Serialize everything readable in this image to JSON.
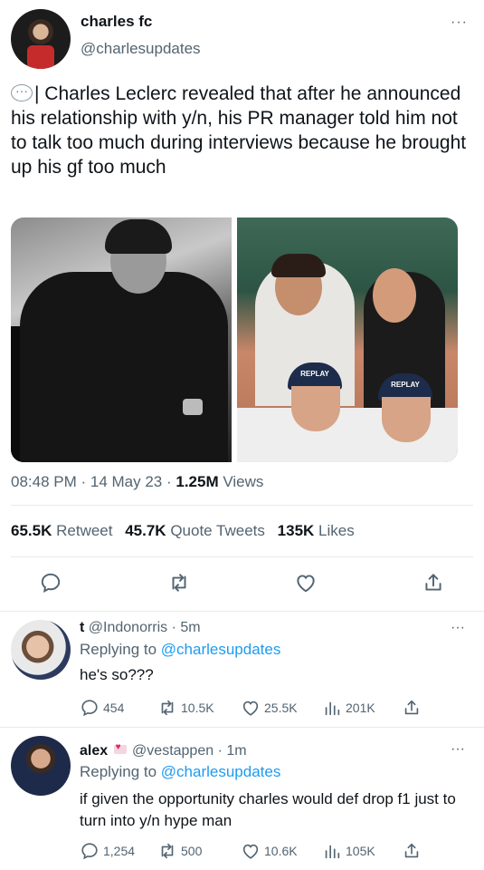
{
  "tweet": {
    "author_name": "charles fc",
    "author_handle": "@charlesupdates",
    "more": "···",
    "text": "| Charles Leclerc revealed that after he announced his relationship with y/n, his PR manager told him not to talk too much during interviews because he brought up his gf too much",
    "time": "08:48 PM · 14 May 23 · ",
    "views_count": "1.25M",
    "views_label": " Views",
    "photo_right_cap_text": "REPLAY",
    "stats": {
      "retweets_count": "65.5K",
      "retweets_label": "Retweet",
      "quotes_count": "45.7K",
      "quotes_label": "Quote Tweets",
      "likes_count": "135K",
      "likes_label": "Likes"
    },
    "actions": [
      "reply-icon",
      "retweet-icon",
      "like-icon",
      "share-icon"
    ]
  },
  "replies": [
    {
      "name": "t",
      "handle": "@Indonorris",
      "time": "5m",
      "replying_label": "Replying to",
      "replying_to": "@charlesupdates",
      "text": "he's so???",
      "reply_count": "454",
      "retweet_count": "10.5K",
      "like_count": "25.5K",
      "view_count": "201K"
    },
    {
      "name": "alex",
      "handle": "@vestappen",
      "time": "1m",
      "replying_label": "Replying to",
      "replying_to": "@charlesupdates",
      "text": "if given the opportunity charles would def drop f1 just to turn into y/n hype man",
      "reply_count": "1,254",
      "retweet_count": "500",
      "like_count": "10.6K",
      "view_count": "105K"
    }
  ],
  "colors": {
    "link": "#1d9bf0",
    "secondary_text": "#536471",
    "primary_text": "#0f1419",
    "divider": "#e6e9ec"
  }
}
